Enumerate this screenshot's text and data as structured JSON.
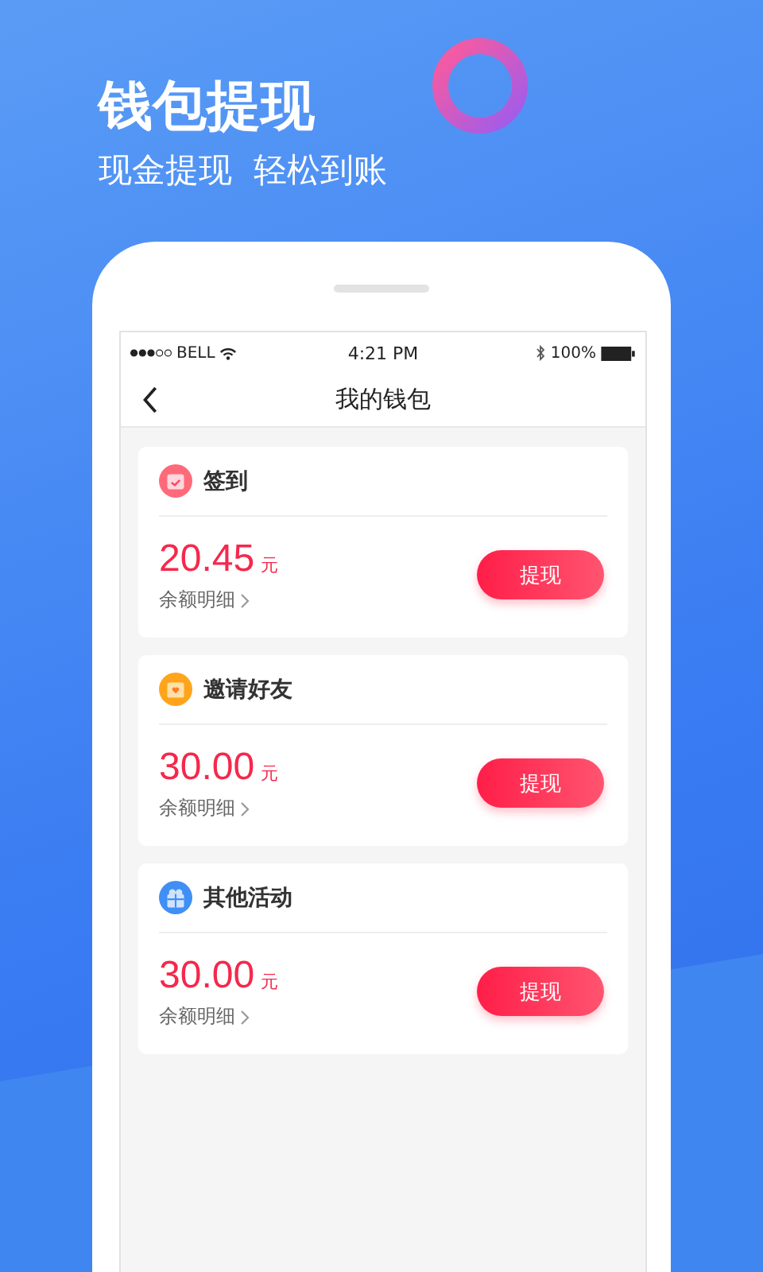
{
  "banner": {
    "title": "钱包提现",
    "subtitle": "现金提现  轻松到账"
  },
  "status_bar": {
    "carrier": "BELL",
    "time": "4:21 PM",
    "battery": "100%"
  },
  "nav": {
    "title": "我的钱包"
  },
  "cards": [
    {
      "kind": "checkin",
      "title": "签到",
      "amount": "20.45",
      "unit": "元",
      "detail": "余额明细",
      "button": "提现"
    },
    {
      "kind": "invite",
      "title": "邀请好友",
      "amount": "30.00",
      "unit": "元",
      "detail": "余额明细",
      "button": "提现"
    },
    {
      "kind": "other",
      "title": "其他活动",
      "amount": "30.00",
      "unit": "元",
      "detail": "余额明细",
      "button": "提现"
    }
  ]
}
